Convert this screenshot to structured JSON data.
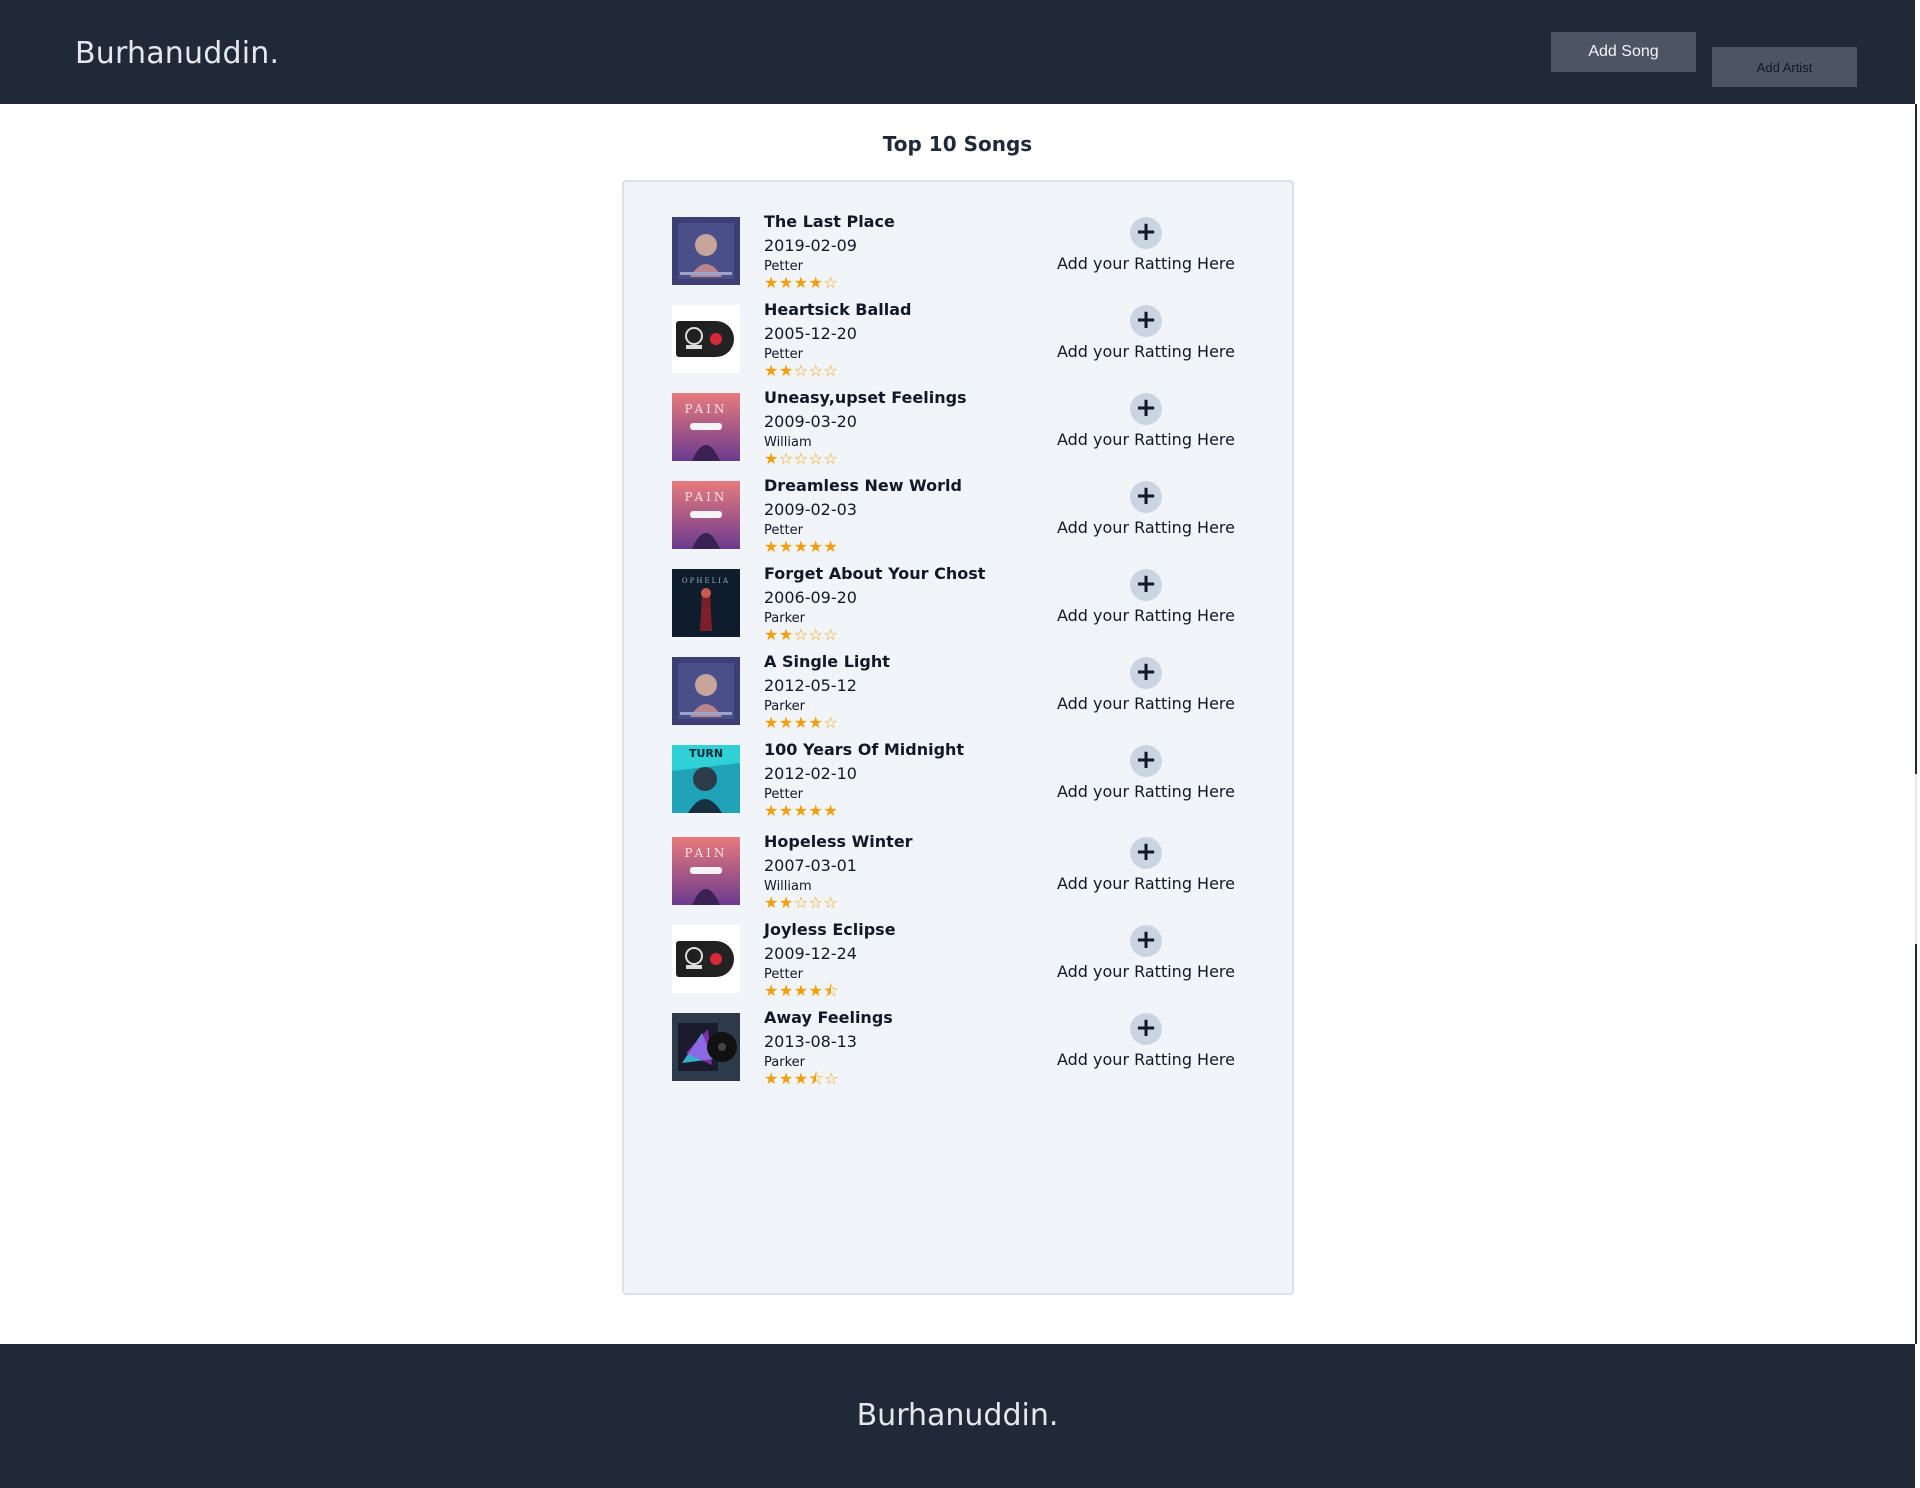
{
  "header": {
    "brand": "Burhanuddin.",
    "add_song_label": "Add Song",
    "add_artist_label": "Add Artist"
  },
  "main": {
    "title": "Top 10 Songs",
    "rate_label": "Add your Ratting Here",
    "songs": [
      {
        "title": "The Last Place",
        "date": "2019-02-09",
        "artist": "Petter",
        "rating": 4,
        "cover_icon": "album-cover-portrait-icon"
      },
      {
        "title": "Heartsick Ballad",
        "date": "2005-12-20",
        "artist": "Petter",
        "rating": 2,
        "cover_icon": "vinyl-music-cover-icon"
      },
      {
        "title": "Uneasy,upset Feelings",
        "date": "2009-03-20",
        "artist": "William",
        "rating": 1,
        "cover_icon": "pain-album-cover-icon"
      },
      {
        "title": "Dreamless New World",
        "date": "2009-02-03",
        "artist": "Petter",
        "rating": 5,
        "cover_icon": "pain-album-cover-icon"
      },
      {
        "title": "Forget About Your Chost",
        "date": "2006-09-20",
        "artist": "Parker",
        "rating": 2,
        "cover_icon": "ophelia-album-cover-icon"
      },
      {
        "title": "A Single Light",
        "date": "2012-05-12",
        "artist": "Parker",
        "rating": 4,
        "cover_icon": "album-cover-portrait-icon"
      },
      {
        "title": "100 Years Of Midnight",
        "date": "2012-02-10",
        "artist": "Petter",
        "rating": 5,
        "cover_icon": "turn-album-cover-icon"
      },
      {
        "title": "Hopeless Winter",
        "date": "2007-03-01",
        "artist": "William",
        "rating": 2,
        "cover_icon": "pain-album-cover-icon"
      },
      {
        "title": "Joyless Eclipse",
        "date": "2009-12-24",
        "artist": "Petter",
        "rating": 4.5,
        "cover_icon": "vinyl-music-cover-icon"
      },
      {
        "title": "Away Feelings",
        "date": "2013-08-13",
        "artist": "Parker",
        "rating": 3.5,
        "cover_icon": "neon-vinyl-cover-icon"
      }
    ]
  },
  "footer": {
    "brand": "Burhanuddin."
  },
  "colors": {
    "nav_bg": "#1f2937",
    "button_bg": "#4b5563",
    "card_bg": "#f1f5f9",
    "star": "#f59e0b",
    "plus_bg": "#cbd5e1"
  }
}
